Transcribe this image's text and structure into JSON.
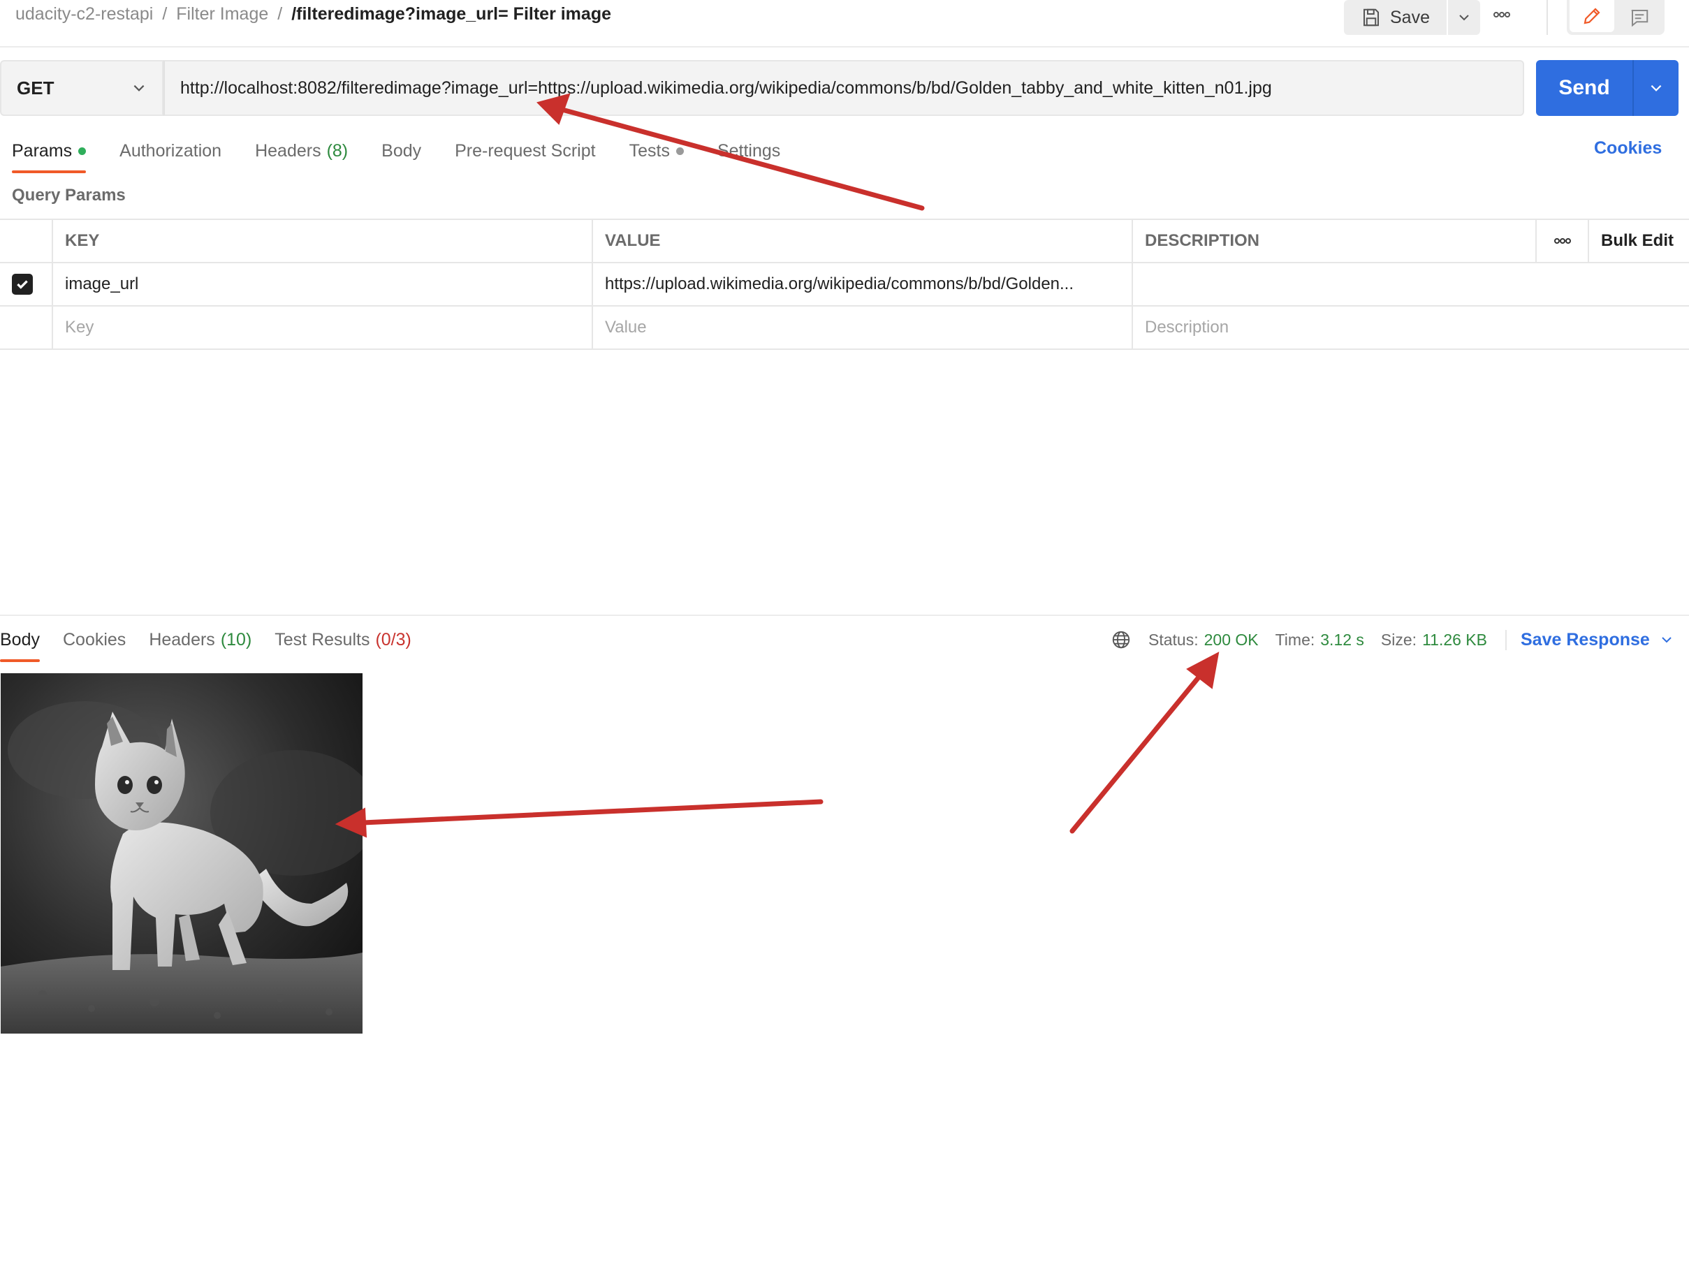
{
  "breadcrumb": {
    "collection": "udacity-c2-restapi",
    "folder": "Filter Image",
    "request": "/filteredimage?image_url= Filter image"
  },
  "toolbar": {
    "save_label": "Save"
  },
  "request": {
    "method": "GET",
    "url": "http://localhost:8082/filteredimage?image_url=https://upload.wikimedia.org/wikipedia/commons/b/bd/Golden_tabby_and_white_kitten_n01.jpg",
    "send_label": "Send"
  },
  "tabs": {
    "params": "Params",
    "authorization": "Authorization",
    "headers": "Headers",
    "headers_count": "(8)",
    "body": "Body",
    "prerequest": "Pre-request Script",
    "tests": "Tests",
    "settings": "Settings",
    "cookies": "Cookies"
  },
  "query_params": {
    "title": "Query Params",
    "columns": {
      "key": "KEY",
      "value": "VALUE",
      "description": "DESCRIPTION",
      "bulk_edit": "Bulk Edit"
    },
    "rows": [
      {
        "checked": true,
        "key": "image_url",
        "value": "https://upload.wikimedia.org/wikipedia/commons/b/bd/Golden...",
        "description": ""
      }
    ],
    "placeholders": {
      "key": "Key",
      "value": "Value",
      "description": "Description"
    }
  },
  "response": {
    "tabs": {
      "body": "Body",
      "cookies": "Cookies",
      "headers": "Headers",
      "headers_count": "(10)",
      "test_results": "Test Results",
      "test_results_count": "(0/3)"
    },
    "status_label": "Status:",
    "status_value": "200 OK",
    "time_label": "Time:",
    "time_value": "3.12 s",
    "size_label": "Size:",
    "size_value": "11.26 KB",
    "save_response": "Save Response"
  },
  "colors": {
    "accent_blue": "#2f6ee0",
    "tab_underline": "#f05a28",
    "success_green": "#2e8a3e",
    "annotation_red": "#c9302c"
  }
}
